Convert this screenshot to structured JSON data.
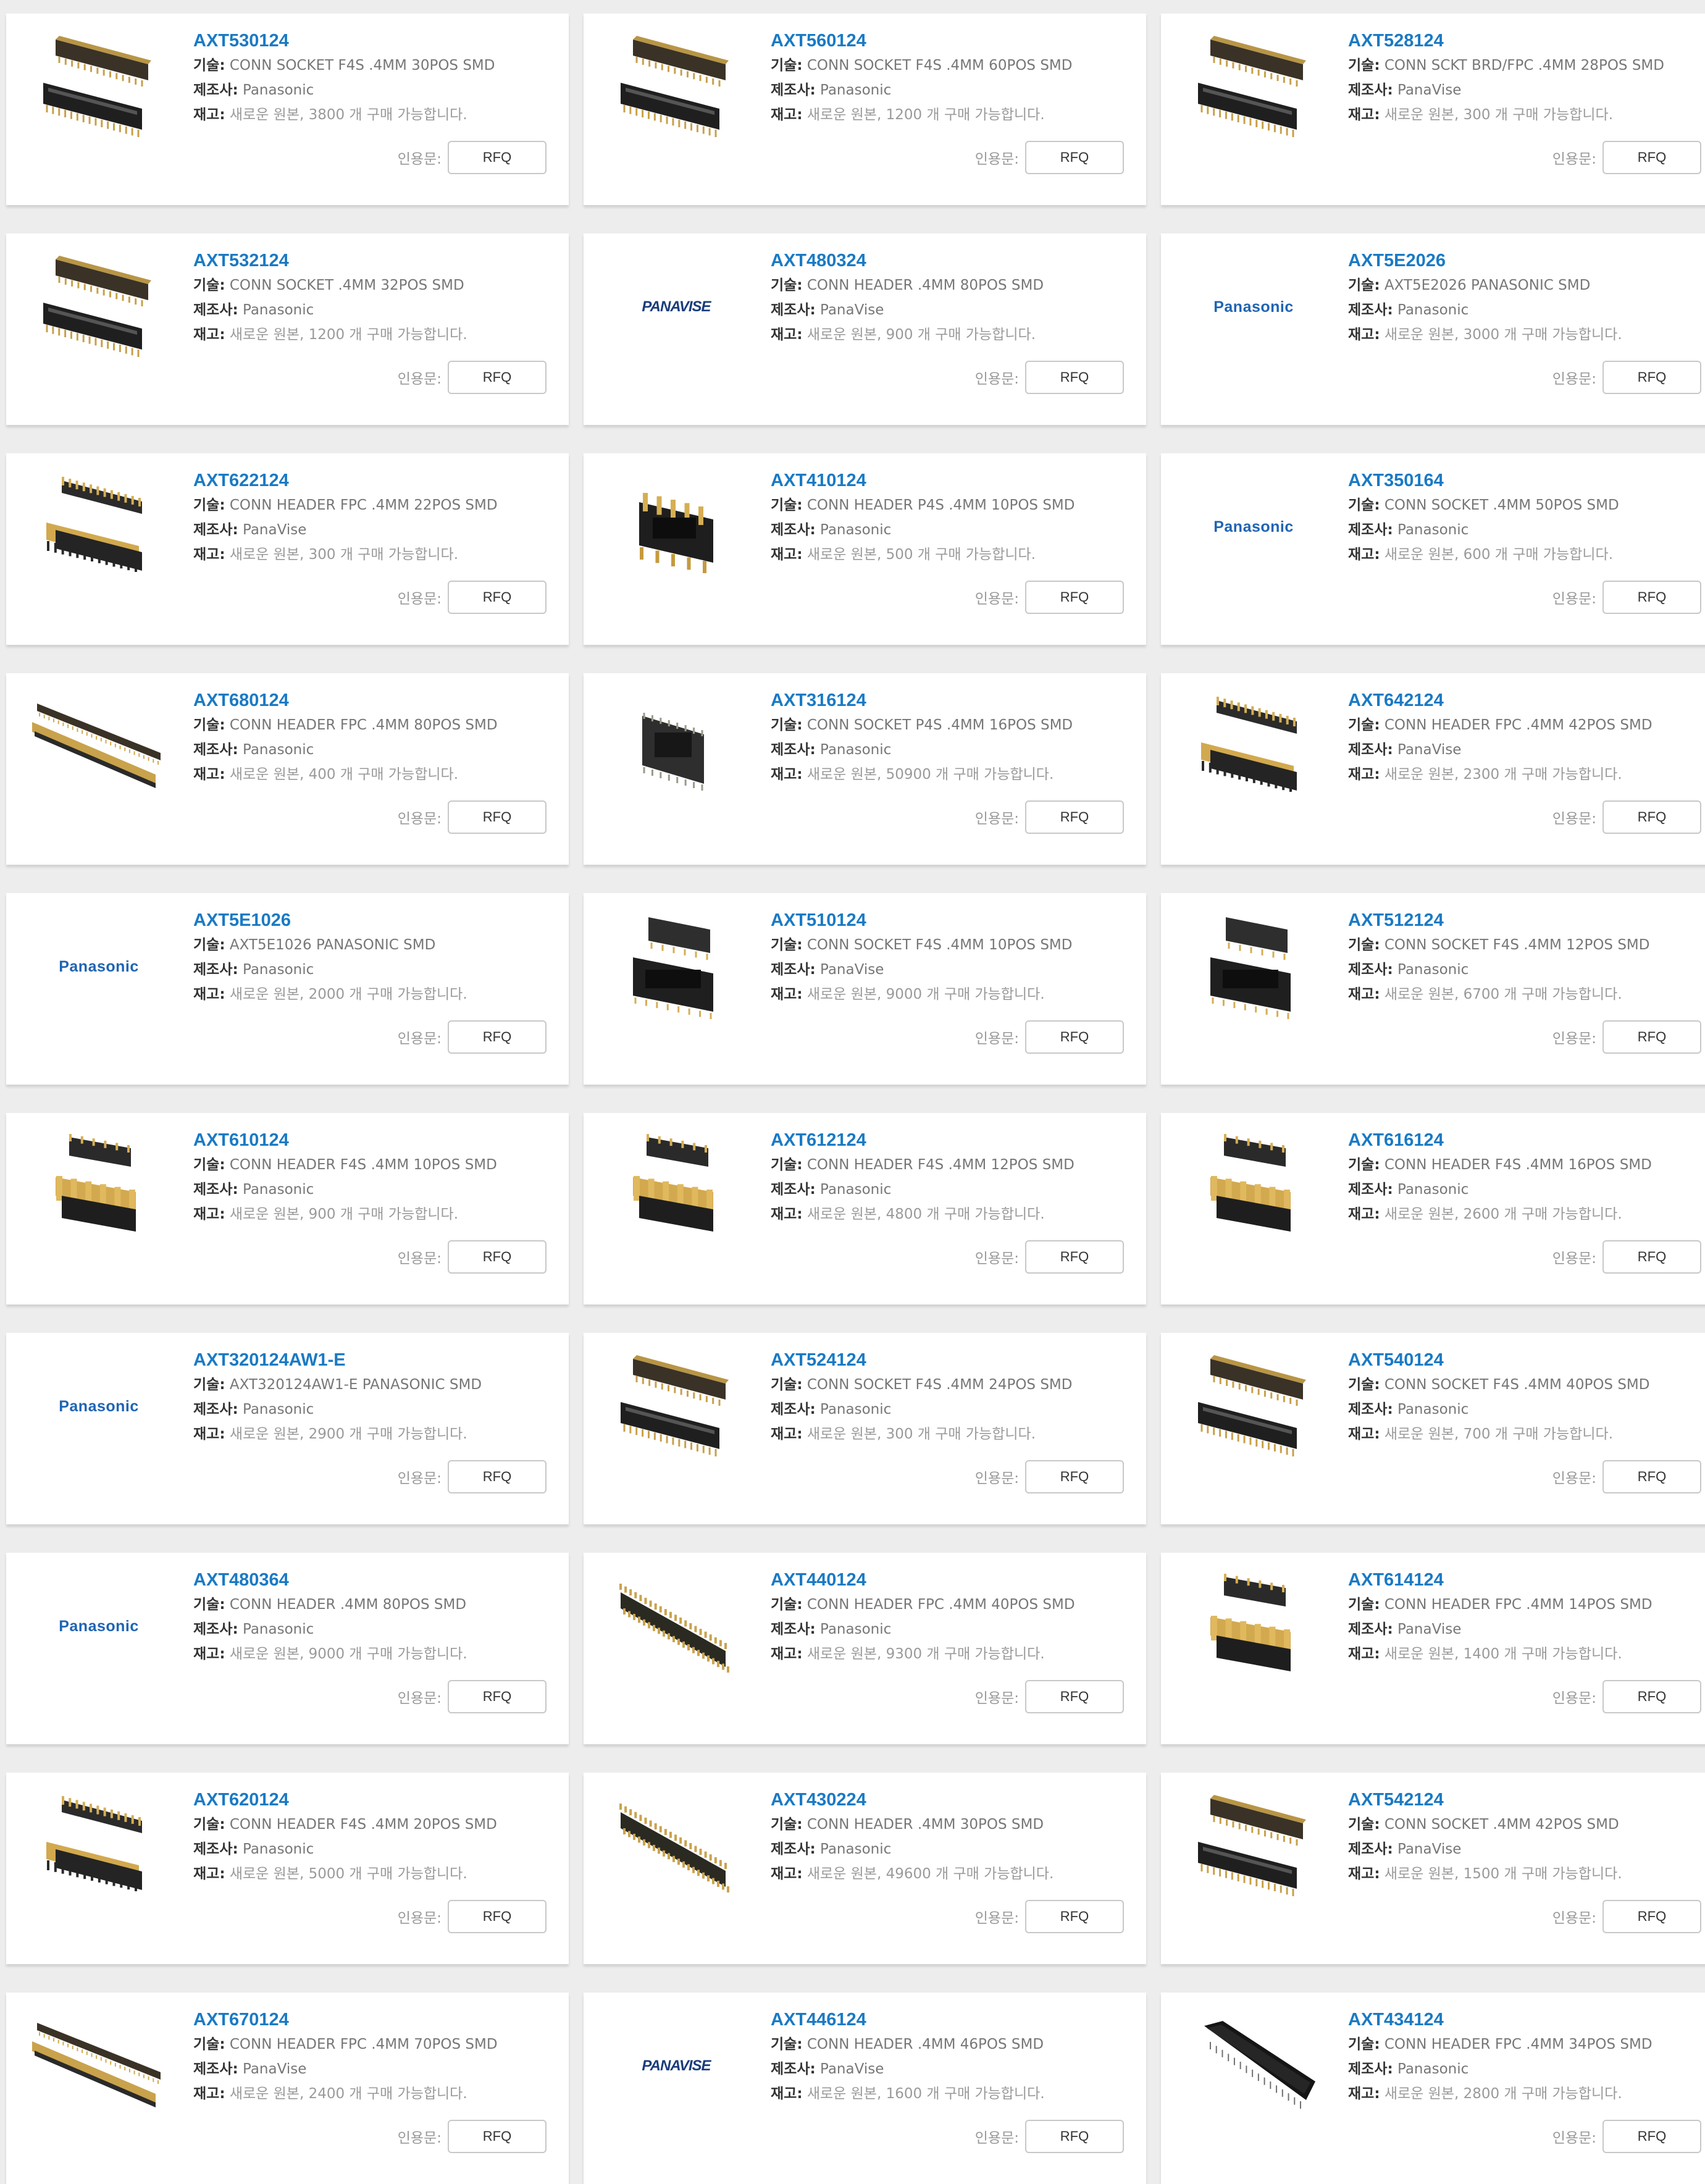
{
  "labels": {
    "tech": "기술:",
    "maker": "제조사:",
    "stock": "재고:",
    "quote": "인용문:",
    "rfq": "RFQ"
  },
  "logos": {
    "panasonic": "Panasonic",
    "panavise": "PANAVISE"
  },
  "products": [
    {
      "pn": "AXT530124",
      "desc": "CONN SOCKET F4S .4MM 30POS SMD",
      "maker": "Panasonic",
      "stock": "새로운 원본, 3800 개 구매 가능합니다.",
      "image": "socket-pair-icon"
    },
    {
      "pn": "AXT560124",
      "desc": "CONN SOCKET F4S .4MM 60POS SMD",
      "maker": "Panasonic",
      "stock": "새로운 원본, 1200 개 구매 가능합니다.",
      "image": "socket-pair-icon"
    },
    {
      "pn": "AXT528124",
      "desc": "CONN SCKT BRD/FPC .4MM 28POS SMD",
      "maker": "PanaVise",
      "stock": "새로운 원본, 300 개 구매 가능합니다.",
      "image": "socket-pair-icon"
    },
    {
      "pn": "AXT532124",
      "desc": "CONN SOCKET .4MM 32POS SMD",
      "maker": "Panasonic",
      "stock": "새로운 원본, 1200 개 구매 가능합니다.",
      "image": "socket-pair-icon"
    },
    {
      "pn": "AXT480324",
      "desc": "CONN HEADER .4MM 80POS SMD",
      "maker": "PanaVise",
      "stock": "새로운 원본, 900 개 구매 가능합니다.",
      "image": "panavise-logo"
    },
    {
      "pn": "AXT5E2026",
      "desc": "AXT5E2026 PANASONIC SMD",
      "maker": "Panasonic",
      "stock": "새로운 원본, 3000 개 구매 가능합니다.",
      "image": "panasonic-logo"
    },
    {
      "pn": "AXT622124",
      "desc": "CONN HEADER FPC .4MM 22POS SMD",
      "maker": "PanaVise",
      "stock": "새로운 원본, 300 개 구매 가능합니다.",
      "image": "header-pair-icon"
    },
    {
      "pn": "AXT410124",
      "desc": "CONN HEADER P4S .4MM 10POS SMD",
      "maker": "Panasonic",
      "stock": "새로운 원본, 500 개 구매 가능합니다.",
      "image": "small-header-icon"
    },
    {
      "pn": "AXT350164",
      "desc": "CONN SOCKET .4MM 50POS SMD",
      "maker": "Panasonic",
      "stock": "새로운 원본, 600 개 구매 가능합니다.",
      "image": "panasonic-logo"
    },
    {
      "pn": "AXT680124",
      "desc": "CONN HEADER FPC .4MM 80POS SMD",
      "maker": "Panasonic",
      "stock": "새로운 원본, 400 개 구매 가능합니다.",
      "image": "long-header-icon"
    },
    {
      "pn": "AXT316124",
      "desc": "CONN SOCKET P4S .4MM 16POS SMD",
      "maker": "Panasonic",
      "stock": "새로운 원본, 50900 개 구매 가능합니다.",
      "image": "small-socket-icon"
    },
    {
      "pn": "AXT642124",
      "desc": "CONN HEADER FPC .4MM 42POS SMD",
      "maker": "PanaVise",
      "stock": "새로운 원본, 2300 개 구매 가능합니다.",
      "image": "header-pair-icon"
    },
    {
      "pn": "AXT5E1026",
      "desc": "AXT5E1026 PANASONIC SMD",
      "maker": "Panasonic",
      "stock": "새로운 원본, 2000 개 구매 가능합니다.",
      "image": "panasonic-logo"
    },
    {
      "pn": "AXT510124",
      "desc": "CONN SOCKET F4S .4MM 10POS SMD",
      "maker": "PanaVise",
      "stock": "새로운 원본, 9000 개 구매 가능합니다.",
      "image": "small-socket-pair-icon"
    },
    {
      "pn": "AXT512124",
      "desc": "CONN SOCKET F4S .4MM 12POS SMD",
      "maker": "Panasonic",
      "stock": "새로운 원본, 6700 개 구매 가능합니다.",
      "image": "small-socket-pair-icon"
    },
    {
      "pn": "AXT610124",
      "desc": "CONN HEADER F4S .4MM 10POS SMD",
      "maker": "Panasonic",
      "stock": "새로운 원본, 900 개 구매 가능합니다.",
      "image": "small-header-pair-icon"
    },
    {
      "pn": "AXT612124",
      "desc": "CONN HEADER F4S .4MM 12POS SMD",
      "maker": "Panasonic",
      "stock": "새로운 원본, 4800 개 구매 가능합니다.",
      "image": "small-header-pair-icon"
    },
    {
      "pn": "AXT616124",
      "desc": "CONN HEADER F4S .4MM 16POS SMD",
      "maker": "Panasonic",
      "stock": "새로운 원본, 2600 개 구매 가능합니다.",
      "image": "small-header-pair-icon"
    },
    {
      "pn": "AXT320124AW1-E",
      "desc": "AXT320124AW1-E PANASONIC SMD",
      "maker": "Panasonic",
      "stock": "새로운 원본, 2900 개 구매 가능합니다.",
      "image": "panasonic-logo"
    },
    {
      "pn": "AXT524124",
      "desc": "CONN SOCKET F4S .4MM 24POS SMD",
      "maker": "Panasonic",
      "stock": "새로운 원본, 300 개 구매 가능합니다.",
      "image": "socket-pair-icon"
    },
    {
      "pn": "AXT540124",
      "desc": "CONN SOCKET F4S .4MM 40POS SMD",
      "maker": "Panasonic",
      "stock": "새로운 원본, 700 개 구매 가능합니다.",
      "image": "socket-pair-icon"
    },
    {
      "pn": "AXT480364",
      "desc": "CONN HEADER .4MM 80POS SMD",
      "maker": "Panasonic",
      "stock": "새로운 원본, 9000 개 구매 가능합니다.",
      "image": "panasonic-logo"
    },
    {
      "pn": "AXT440124",
      "desc": "CONN HEADER FPC .4MM 40POS SMD",
      "maker": "Panasonic",
      "stock": "새로운 원본, 9300 개 구매 가능합니다.",
      "image": "gold-strip-icon"
    },
    {
      "pn": "AXT614124",
      "desc": "CONN HEADER FPC .4MM 14POS SMD",
      "maker": "PanaVise",
      "stock": "새로운 원본, 1400 개 구매 가능합니다.",
      "image": "small-header-pair-icon"
    },
    {
      "pn": "AXT620124",
      "desc": "CONN HEADER F4S .4MM 20POS SMD",
      "maker": "Panasonic",
      "stock": "새로운 원본, 5000 개 구매 가능합니다.",
      "image": "header-pair-icon"
    },
    {
      "pn": "AXT430224",
      "desc": "CONN HEADER .4MM 30POS SMD",
      "maker": "Panasonic",
      "stock": "새로운 원본, 49600 개 구매 가능합니다.",
      "image": "gold-strip-icon"
    },
    {
      "pn": "AXT542124",
      "desc": "CONN SOCKET .4MM 42POS SMD",
      "maker": "PanaVise",
      "stock": "새로운 원본, 1500 개 구매 가능합니다.",
      "image": "socket-pair-icon"
    },
    {
      "pn": "AXT670124",
      "desc": "CONN HEADER FPC .4MM 70POS SMD",
      "maker": "PanaVise",
      "stock": "새로운 원본, 2400 개 구매 가능합니다.",
      "image": "long-header-icon"
    },
    {
      "pn": "AXT446124",
      "desc": "CONN HEADER .4MM 46POS SMD",
      "maker": "PanaVise",
      "stock": "새로운 원본, 1600 개 구매 가능합니다.",
      "image": "panavise-logo"
    },
    {
      "pn": "AXT434124",
      "desc": "CONN HEADER FPC .4MM 34POS SMD",
      "maker": "Panasonic",
      "stock": "새로운 원본, 2800 개 구매 가능합니다.",
      "image": "dark-strip-icon"
    }
  ]
}
